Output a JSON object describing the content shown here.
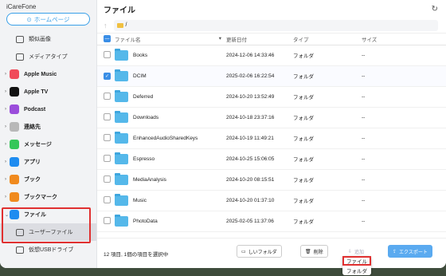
{
  "app": {
    "title": "iCareFone",
    "home_label": "ホームページ"
  },
  "sidebar": {
    "items": [
      {
        "label": "類似画像",
        "type": "sub",
        "icon": "image-icon"
      },
      {
        "label": "メディアタイプ",
        "type": "sub",
        "icon": "media-icon"
      },
      {
        "label": "Apple Music",
        "type": "top",
        "icon": "music-icon",
        "color": "#f04a5a"
      },
      {
        "label": "Apple TV",
        "type": "top",
        "icon": "tv-icon",
        "color": "#111111"
      },
      {
        "label": "Podcast",
        "type": "top",
        "icon": "podcast-icon",
        "color": "#9b4ddb"
      },
      {
        "label": "連絡先",
        "type": "top",
        "icon": "contacts-icon",
        "color": "#b8b8b8"
      },
      {
        "label": "メッセージ",
        "type": "top",
        "icon": "message-icon",
        "color": "#34c759"
      },
      {
        "label": "アプリ",
        "type": "top",
        "icon": "appstore-icon",
        "color": "#1f8cf0"
      },
      {
        "label": "ブック",
        "type": "top",
        "icon": "book-icon",
        "color": "#f08a1e"
      },
      {
        "label": "ブックマーク",
        "type": "top",
        "icon": "bookmark-icon",
        "color": "#f08a1e"
      },
      {
        "label": "ファイル",
        "type": "top",
        "icon": "folder-icon",
        "color": "#1f8cf0"
      },
      {
        "label": "ユーザーファイル",
        "type": "sub",
        "icon": "user-file-icon"
      },
      {
        "label": "仮想USBドライブ",
        "type": "sub",
        "icon": "usb-icon"
      }
    ]
  },
  "main": {
    "title": "ファイル",
    "path": "/",
    "columns": {
      "name": "ファイル名",
      "date": "更新日付",
      "type": "タイプ",
      "size": "サイズ"
    },
    "rows": [
      {
        "name": "Books",
        "date": "2024-12-06 14:33:46",
        "type": "フォルダ",
        "size": "--",
        "checked": false
      },
      {
        "name": "DCIM",
        "date": "2025-02-06 16:22:54",
        "type": "フォルダ",
        "size": "--",
        "checked": true
      },
      {
        "name": "Deferred",
        "date": "2024-10-20 13:52:49",
        "type": "フォルダ",
        "size": "--",
        "checked": false
      },
      {
        "name": "Downloads",
        "date": "2024-10-18 23:37:16",
        "type": "フォルダ",
        "size": "--",
        "checked": false
      },
      {
        "name": "EnhancedAudioSharedKeys",
        "date": "2024-10-19 11:49:21",
        "type": "フォルダ",
        "size": "--",
        "checked": false
      },
      {
        "name": "Espresso",
        "date": "2024-10-25 15:06:05",
        "type": "フォルダ",
        "size": "--",
        "checked": false
      },
      {
        "name": "MediaAnalysis",
        "date": "2024-10-20 08:15:51",
        "type": "フォルダ",
        "size": "--",
        "checked": false
      },
      {
        "name": "Music",
        "date": "2024-10-20 01:37:10",
        "type": "フォルダ",
        "size": "--",
        "checked": false
      },
      {
        "name": "PhotoData",
        "date": "2025-02-05 11:37:06",
        "type": "フォルダ",
        "size": "--",
        "checked": false
      }
    ]
  },
  "footer": {
    "status": "12 項目, 1個の項目を選択中",
    "new_folder": "しいフォルダ",
    "delete": "削除",
    "import": "追加",
    "export": "エクスポート"
  },
  "dropdown": {
    "items": [
      "ファイル",
      "フォルダ"
    ]
  }
}
